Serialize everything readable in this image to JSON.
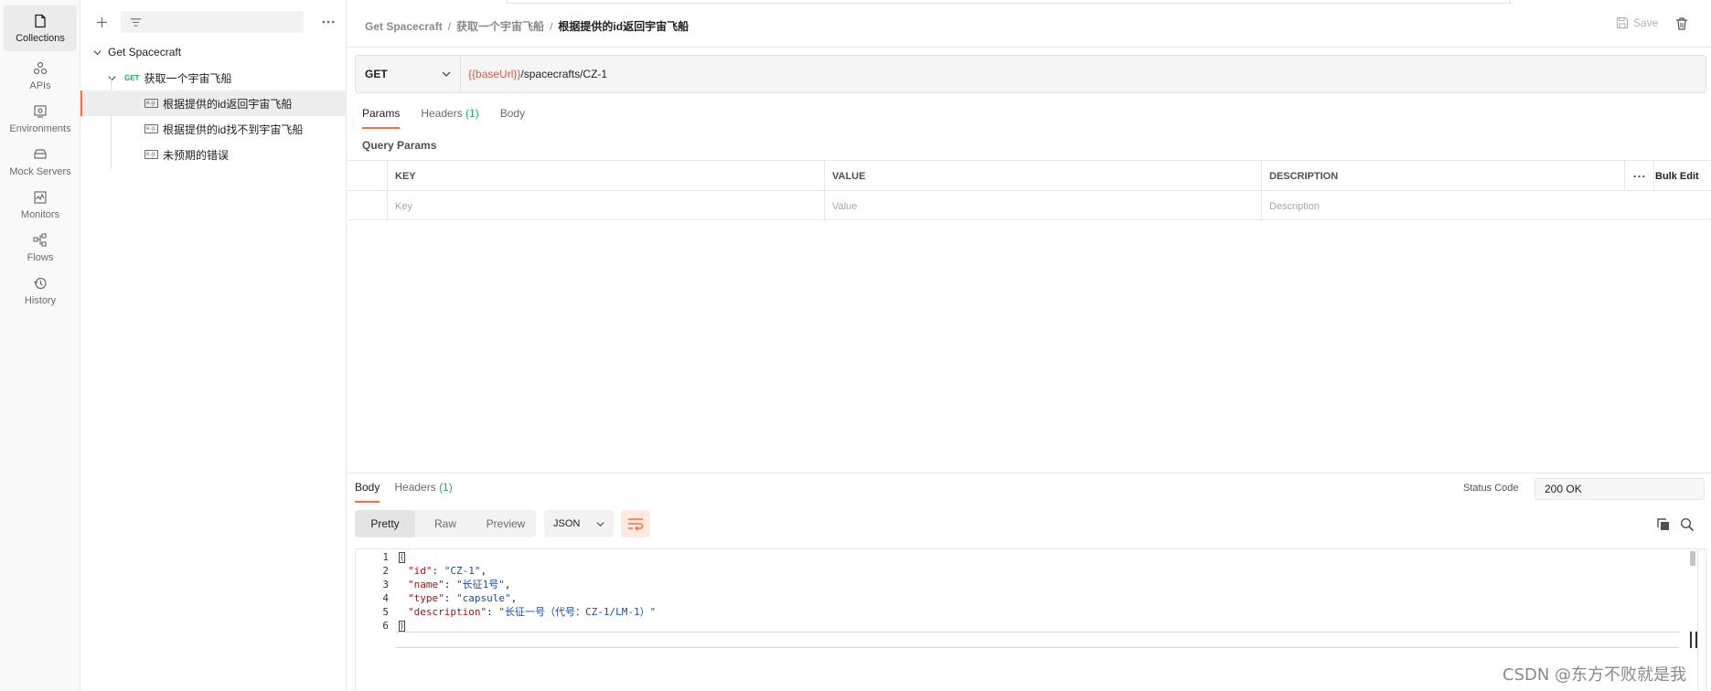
{
  "rail": {
    "items": [
      {
        "label": "Collections",
        "icon": "collections-icon"
      },
      {
        "label": "APIs",
        "icon": "apis-icon"
      },
      {
        "label": "Environments",
        "icon": "environments-icon"
      },
      {
        "label": "Mock Servers",
        "icon": "mock-servers-icon"
      },
      {
        "label": "Monitors",
        "icon": "monitors-icon"
      },
      {
        "label": "Flows",
        "icon": "flows-icon"
      },
      {
        "label": "History",
        "icon": "history-icon"
      }
    ]
  },
  "sidebar": {
    "collection": "Get Spacecraft",
    "request": {
      "method": "GET",
      "name": "获取一个宇宙飞船"
    },
    "examples": [
      {
        "tag": "e.g.",
        "name": "根据提供的id返回宇宙飞船"
      },
      {
        "tag": "e.g.",
        "name": "根据提供的id找不到宇宙飞船"
      },
      {
        "tag": "e.g.",
        "name": "未预期的错误"
      }
    ]
  },
  "header": {
    "breadcrumb": [
      "Get Spacecraft",
      "获取一个宇宙飞船"
    ],
    "current": "根据提供的id返回宇宙飞船",
    "separator": "/",
    "save_label": "Save"
  },
  "request": {
    "method": "GET",
    "url_var": "{{baseUrl}}",
    "url_path": "/spacecrafts/CZ-1",
    "tabs": {
      "params": "Params",
      "headers": "Headers",
      "headers_count": "(1)",
      "body": "Body"
    },
    "query_params_label": "Query Params",
    "table": {
      "columns": [
        "KEY",
        "VALUE",
        "DESCRIPTION"
      ],
      "placeholders": [
        "Key",
        "Value",
        "Description"
      ],
      "more": "•••",
      "bulk_edit": "Bulk Edit"
    }
  },
  "response": {
    "tabs": {
      "body": "Body",
      "headers": "Headers",
      "headers_count": "(1)"
    },
    "status_label": "Status Code",
    "status_value": "200 OK",
    "views": [
      "Pretty",
      "Raw",
      "Preview"
    ],
    "format": "JSON",
    "lines": [
      {
        "n": "1",
        "key": "",
        "value": "",
        "trail": ""
      },
      {
        "n": "2",
        "key": "\"id\"",
        "value": "\"CZ-1\"",
        "trail": ","
      },
      {
        "n": "3",
        "key": "\"name\"",
        "value": "\"长征1号\"",
        "trail": ","
      },
      {
        "n": "4",
        "key": "\"type\"",
        "value": "\"capsule\"",
        "trail": ","
      },
      {
        "n": "5",
        "key": "\"description\"",
        "value": "\"长征一号（代号：CZ-1/LM-1）\"",
        "trail": ""
      },
      {
        "n": "6",
        "key": "",
        "value": "",
        "trail": ""
      }
    ],
    "brace_open": "{",
    "brace_close": "}",
    "colon": ": "
  },
  "watermark": "CSDN @东方不败就是我",
  "colors": {
    "accent": "#ff6c37",
    "get": "#0cbb52",
    "var": "#e2563b"
  }
}
